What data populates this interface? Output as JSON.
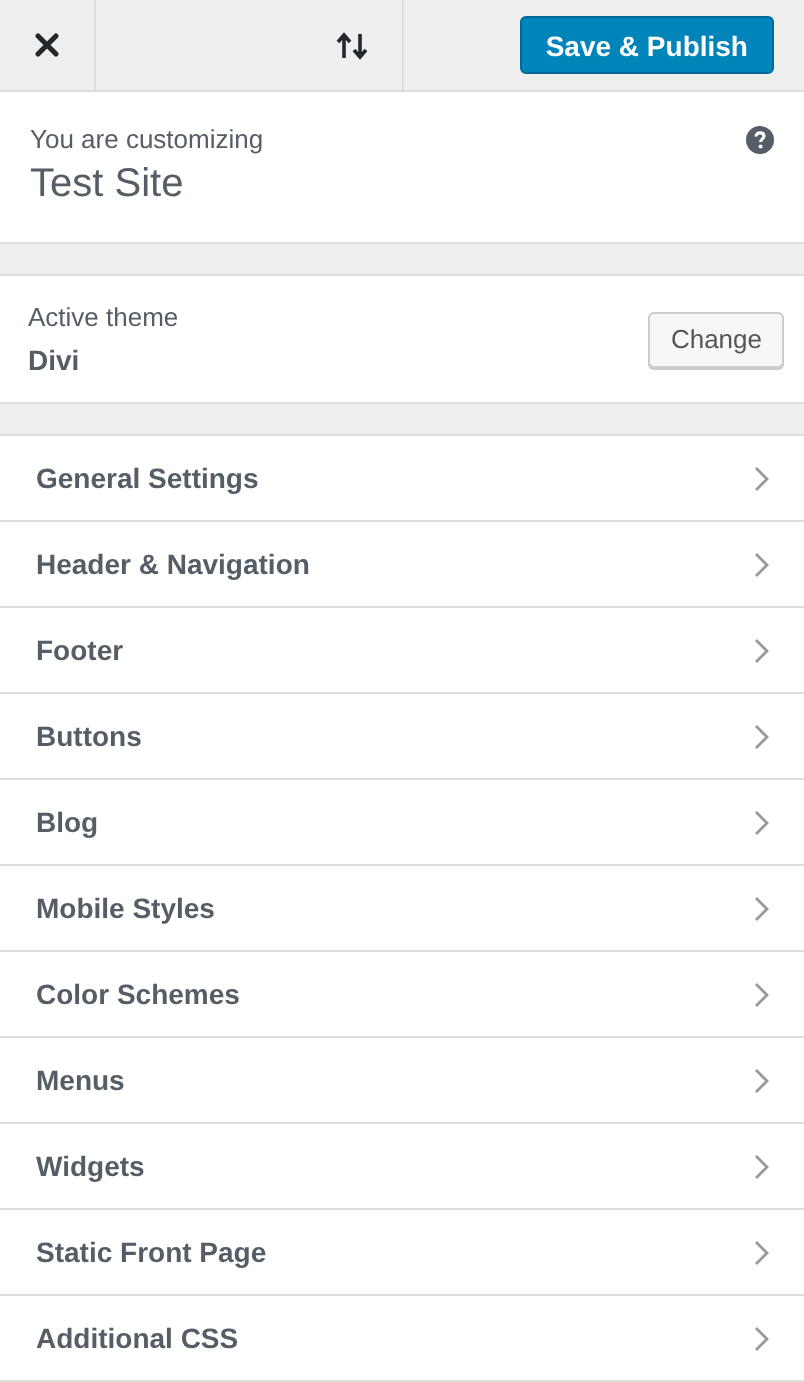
{
  "header": {
    "publish_button": "Save & Publish"
  },
  "info": {
    "label": "You are customizing",
    "site_title": "Test Site"
  },
  "theme": {
    "label": "Active theme",
    "name": "Divi",
    "change_button": "Change"
  },
  "sections": [
    {
      "label": "General Settings"
    },
    {
      "label": "Header & Navigation"
    },
    {
      "label": "Footer"
    },
    {
      "label": "Buttons"
    },
    {
      "label": "Blog"
    },
    {
      "label": "Mobile Styles"
    },
    {
      "label": "Color Schemes"
    },
    {
      "label": "Menus"
    },
    {
      "label": "Widgets"
    },
    {
      "label": "Static Front Page"
    },
    {
      "label": "Additional CSS"
    }
  ]
}
